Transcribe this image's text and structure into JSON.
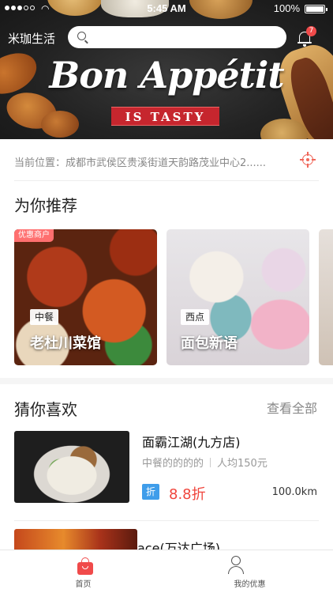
{
  "status_bar": {
    "time": "5:45 AM",
    "battery": "100%"
  },
  "header": {
    "city": "米珈生活",
    "search_placeholder": "",
    "notification_count": "7"
  },
  "banner": {
    "headline": "Bon Appétit",
    "tagline": "IS TASTY"
  },
  "location": {
    "text": "当前位置：成都市武侯区贵溪街道天韵路茂业中心2......"
  },
  "recommend": {
    "title": "为你推荐",
    "cards": [
      {
        "promo": "优惠商户",
        "category": "中餐",
        "name": "老杜川菜馆"
      },
      {
        "promo": "",
        "category": "西点",
        "name": "面包新语"
      }
    ]
  },
  "guess": {
    "title": "猜你喜欢",
    "see_all": "查看全部",
    "items": [
      {
        "name": "面霸江湖(九方店)",
        "category": "中餐的的的的",
        "avg_price": "人均150元",
        "discount_badge": "折",
        "discount": "8.8折",
        "distance": "100.0km"
      },
      {
        "name": "ace(万达广场)"
      }
    ]
  },
  "tabbar": {
    "home": "首页",
    "mine": "我的优惠"
  },
  "colors": {
    "accent": "#f04a4a",
    "discount_badge": "#3f9dea",
    "location_icon": "#f0675a"
  }
}
